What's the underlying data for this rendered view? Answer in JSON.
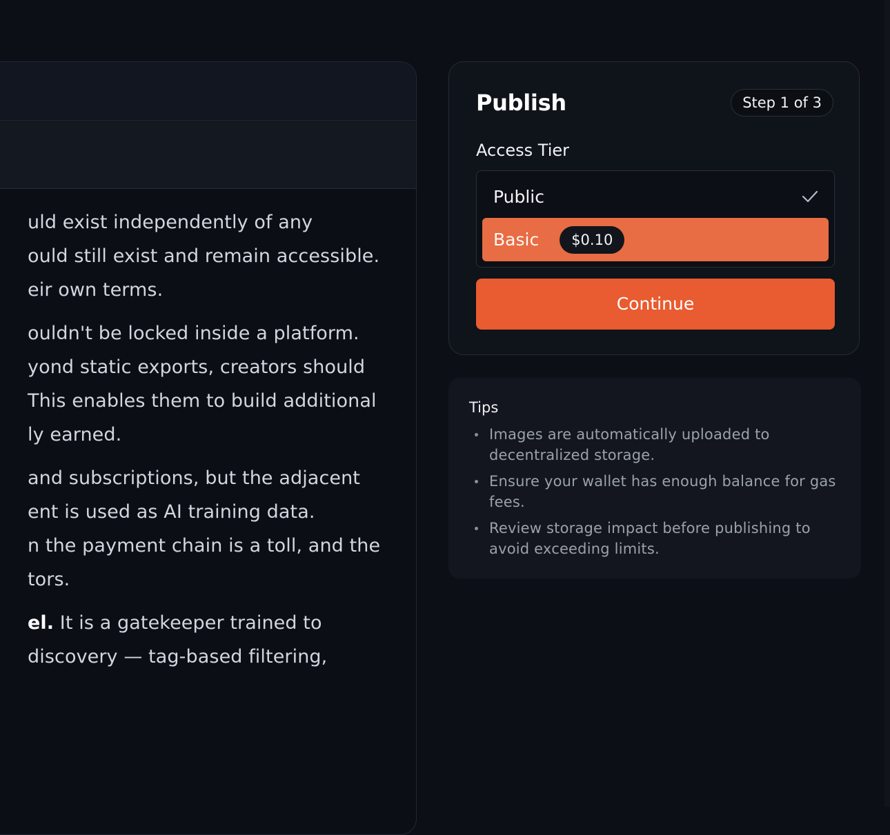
{
  "article": {
    "paragraphs": [
      [
        "uld exist independently of any",
        "ould still exist and remain accessible.",
        "eir own terms."
      ],
      [
        "ouldn't be locked inside a platform.",
        "yond static exports, creators should",
        "This enables them to build additional",
        "ly earned."
      ],
      [
        "and subscriptions, but the adjacent",
        "ent is used as AI training data.",
        "n the payment chain is a toll, and the",
        "tors."
      ]
    ],
    "last": {
      "bold": "el.",
      "line1_rest": " It is a gatekeeper trained to",
      "line2": "discovery — tag-based filtering,"
    }
  },
  "publish": {
    "title": "Publish",
    "step": "Step 1 of 3",
    "access_tier_label": "Access Tier",
    "options": [
      {
        "label": "Public",
        "selected": true
      },
      {
        "label": "Basic",
        "price": "$0.10",
        "highlighted": true
      }
    ],
    "continue_label": "Continue",
    "accent": "#e95b30"
  },
  "tips": {
    "heading": "Tips",
    "items": [
      "Images are automatically uploaded to decentralized storage.",
      "Ensure your wallet has enough balance for gas fees.",
      "Review storage impact before publishing to avoid exceeding limits."
    ]
  }
}
